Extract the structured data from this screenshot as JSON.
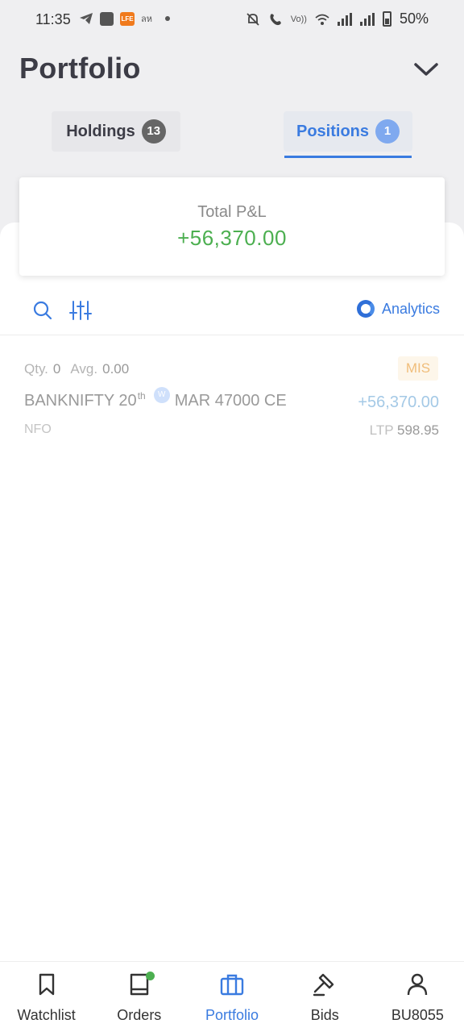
{
  "status_bar": {
    "time": "11:35",
    "carrier_text": "ลห",
    "badge_text": "LFE",
    "volte_text": "Vo))",
    "battery": "50%"
  },
  "header": {
    "title": "Portfolio",
    "chevron_icon": "chevron-down-icon"
  },
  "tabs": [
    {
      "label": "Holdings",
      "count": "13",
      "active": false
    },
    {
      "label": "Positions",
      "count": "1",
      "active": true
    }
  ],
  "summary": {
    "label": "Total P&L",
    "value": "+56,370.00",
    "value_color": "#4caf50"
  },
  "toolbar": {
    "search_icon": "search-icon",
    "filter_icon": "sliders-icon",
    "analytics_label": "Analytics"
  },
  "positions": [
    {
      "qty_label": "Qty.",
      "qty": "0",
      "avg_label": "Avg.",
      "avg": "0.00",
      "product": "MIS",
      "name_prefix": "BANKNIFTY 20",
      "name_sup": "th",
      "weekly_badge": "W",
      "name_suffix": "MAR 47000 CE",
      "pnl": "+56,370.00",
      "exchange": "NFO",
      "ltp_label": "LTP",
      "ltp": "598.95"
    }
  ],
  "bottom_nav": [
    {
      "label": "Watchlist",
      "icon": "bookmark-icon",
      "active": false
    },
    {
      "label": "Orders",
      "icon": "book-icon",
      "active": false
    },
    {
      "label": "Portfolio",
      "icon": "briefcase-icon",
      "active": true
    },
    {
      "label": "Bids",
      "icon": "gavel-icon",
      "active": false
    },
    {
      "label": "BU8055",
      "icon": "user-icon",
      "active": false
    }
  ],
  "colors": {
    "accent": "#3a7be0",
    "profit": "#4caf50",
    "mis_badge_text": "#f0bd7a",
    "background_top": "#efeff1"
  }
}
